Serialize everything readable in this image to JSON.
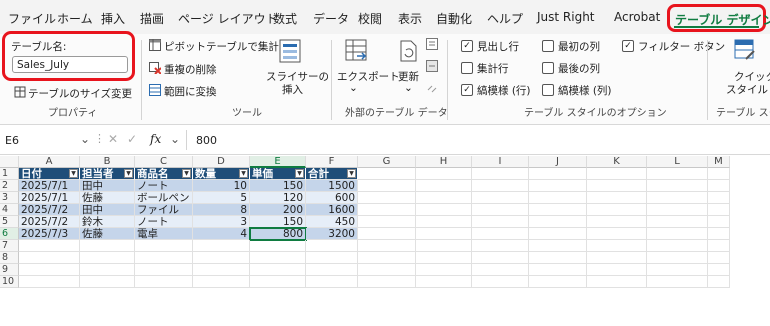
{
  "menu": {
    "tabs": [
      "ファイル",
      "ホーム",
      "挿入",
      "描画",
      "ページ レイアウト",
      "数式",
      "データ",
      "校閲",
      "表示",
      "自動化",
      "ヘルプ",
      "Just Right",
      "Acrobat"
    ],
    "active_tab": "テーブル デザイン"
  },
  "ribbon": {
    "properties": {
      "name_label": "テーブル名:",
      "name_value": "Sales_July",
      "resize": "テーブルのサイズ変更",
      "group": "プロパティ"
    },
    "tools": {
      "pivot": "ピボットテーブルで集計",
      "remove_dup": "重複の削除",
      "convert": "範囲に変換",
      "slicer_1": "スライサーの",
      "slicer_2": "挿入",
      "group": "ツール"
    },
    "external": {
      "export": "エクスポート",
      "refresh": "更新",
      "group": "外部のテーブル データ"
    },
    "style_options": {
      "header_row": "見出し行",
      "total_row": "集計行",
      "banded_rows": "縞模様 (行)",
      "first_col": "最初の列",
      "last_col": "最後の列",
      "banded_cols": "縞模様 (列)",
      "filter_button": "フィルター ボタン",
      "group": "テーブル スタイルのオプション",
      "checked": {
        "header_row": true,
        "total_row": false,
        "banded_rows": true,
        "first_col": false,
        "last_col": false,
        "banded_cols": false,
        "filter_button": true
      }
    },
    "styles": {
      "quick_1": "クイック",
      "quick_2": "スタイル ~",
      "group": "テーブル スタ"
    }
  },
  "formula_bar": {
    "cell_ref": "E6",
    "fx": "fx",
    "value": "800"
  },
  "grid": {
    "columns": [
      "A",
      "B",
      "C",
      "D",
      "E",
      "F",
      "G",
      "H",
      "I",
      "J",
      "K",
      "L",
      "M"
    ],
    "rows": [
      "1",
      "2",
      "3",
      "4",
      "5",
      "6",
      "7",
      "8",
      "9",
      "10"
    ],
    "headers": [
      "日付",
      "担当者",
      "商品名",
      "数量",
      "単価",
      "合計"
    ],
    "data": [
      [
        "2025/7/1",
        "田中",
        "ノート",
        "10",
        "150",
        "1500"
      ],
      [
        "2025/7/1",
        "佐藤",
        "ボールペン",
        "5",
        "120",
        "600"
      ],
      [
        "2025/7/2",
        "田中",
        "ファイル",
        "8",
        "200",
        "1600"
      ],
      [
        "2025/7/2",
        "鈴木",
        "ノート",
        "3",
        "150",
        "450"
      ],
      [
        "2025/7/3",
        "佐藤",
        "電卓",
        "4",
        "800",
        "3200"
      ]
    ],
    "selected_cell": "E6"
  }
}
